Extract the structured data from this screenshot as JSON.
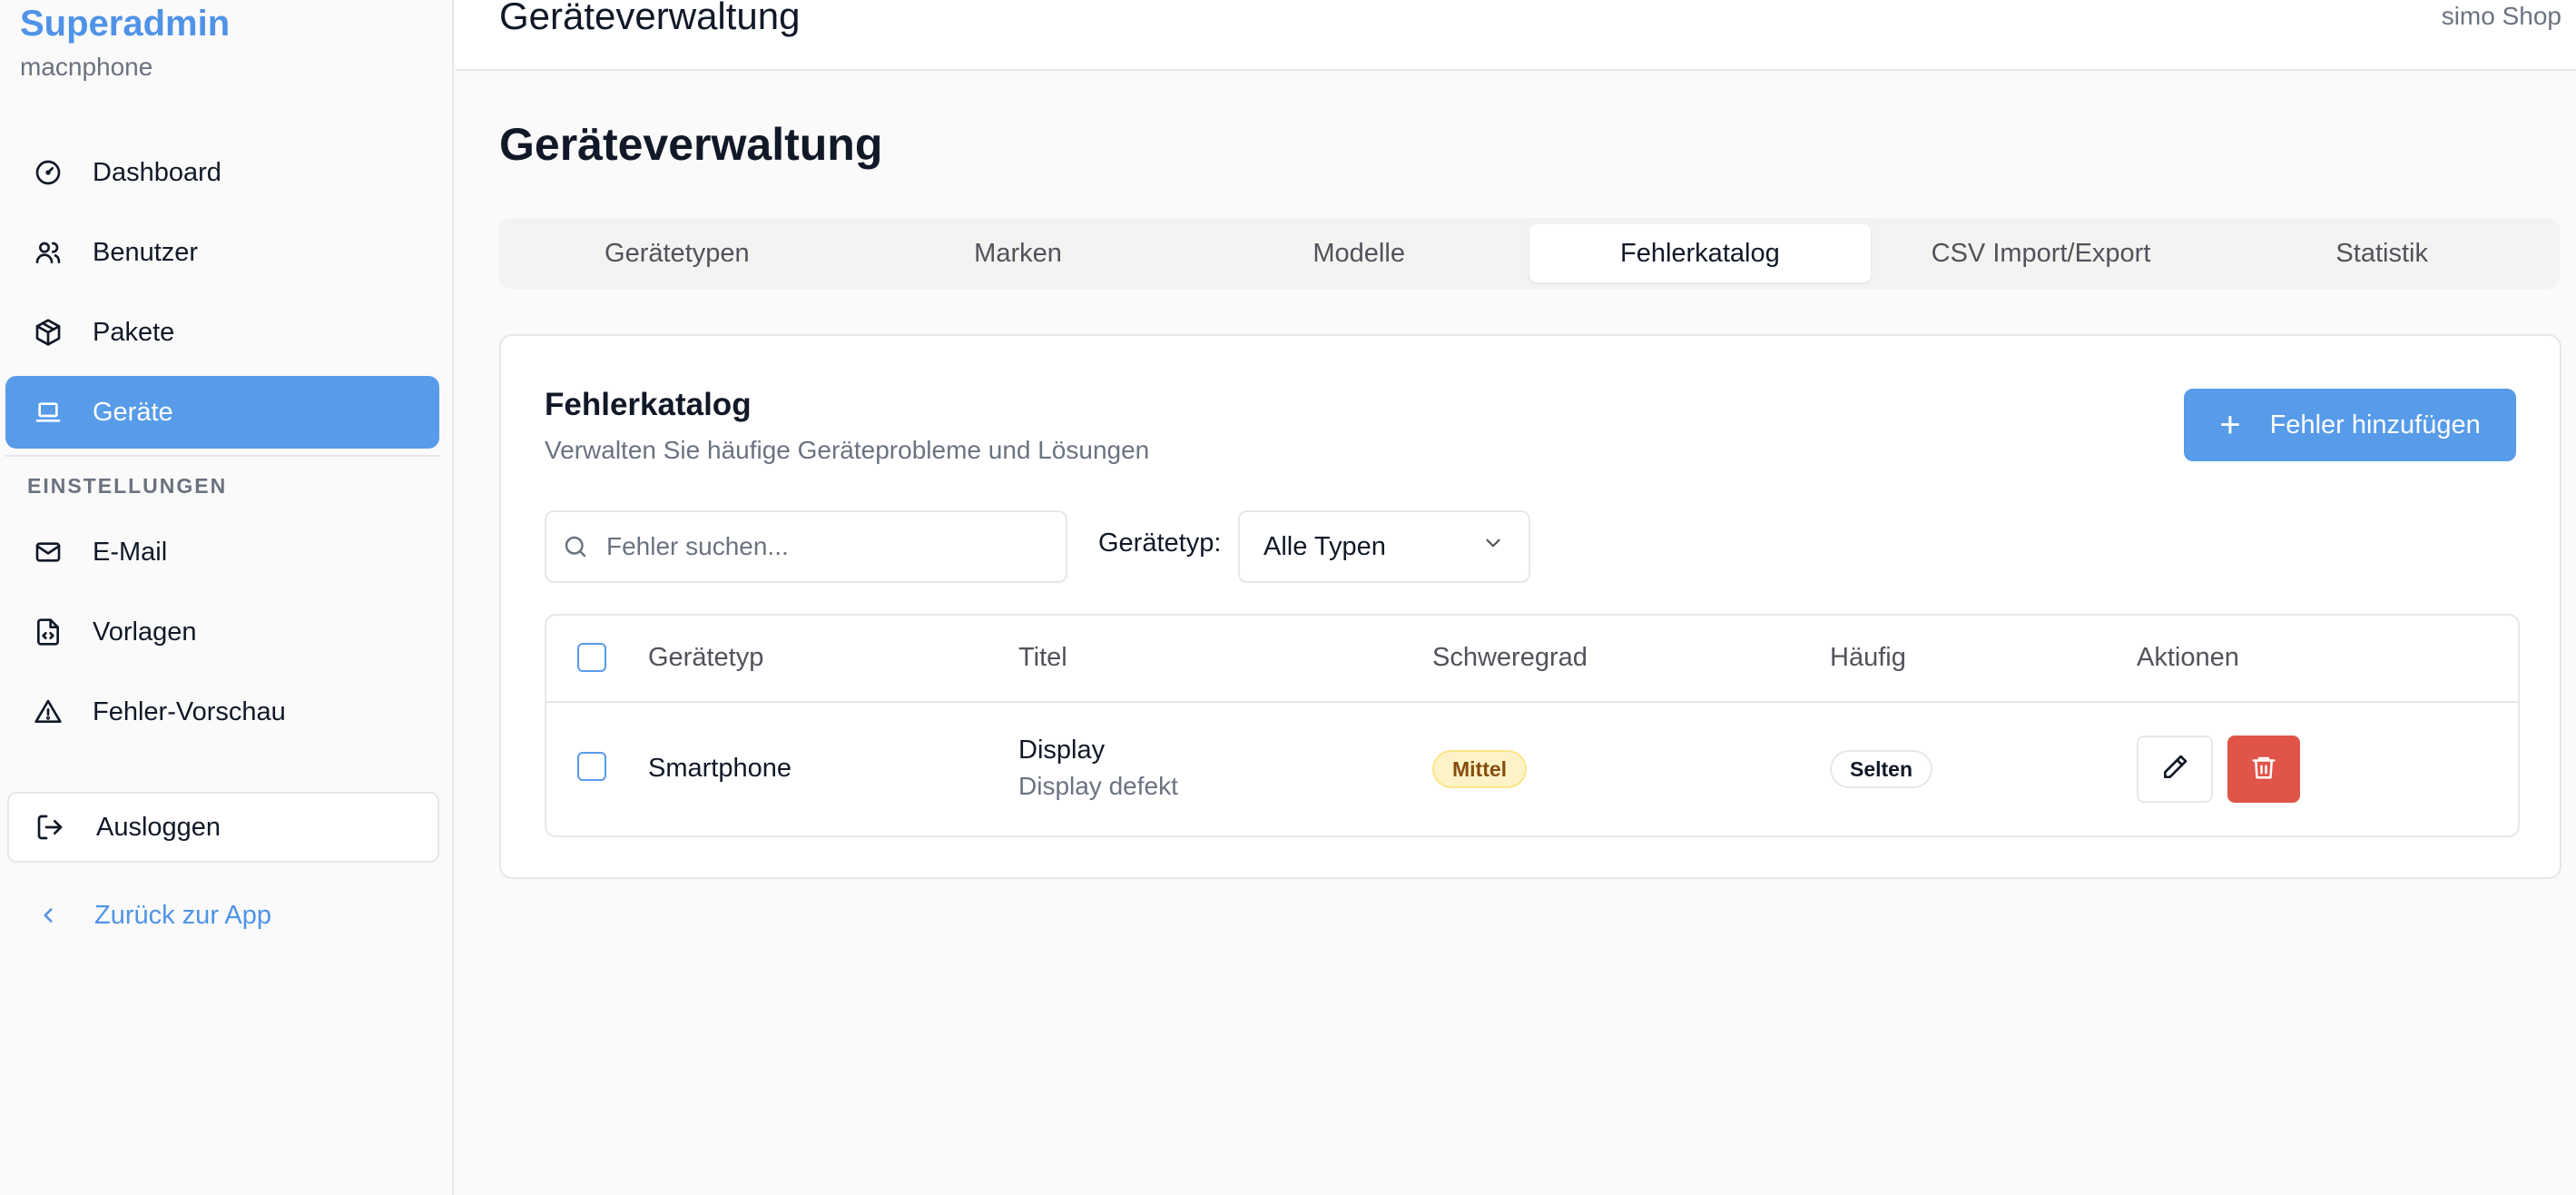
{
  "colors": {
    "accent": "#579be9",
    "brand": "#4f93e8",
    "danger": "#e15449",
    "badge_medium_bg": "#fef3c7"
  },
  "sidebar": {
    "brand_title": "Superadmin",
    "brand_subtitle": "macnphone",
    "items": [
      {
        "label": "Dashboard",
        "icon": "gauge-icon"
      },
      {
        "label": "Benutzer",
        "icon": "users-icon"
      },
      {
        "label": "Pakete",
        "icon": "package-icon"
      },
      {
        "label": "Geräte",
        "icon": "laptop-icon",
        "active": true
      }
    ],
    "section_label": "EINSTELLUNGEN",
    "settings_items": [
      {
        "label": "E-Mail",
        "icon": "mail-icon"
      },
      {
        "label": "Vorlagen",
        "icon": "file-code-icon"
      },
      {
        "label": "Fehler-Vorschau",
        "icon": "alert-triangle-icon"
      }
    ],
    "logout_label": "Ausloggen",
    "back_label": "Zurück zur App"
  },
  "header": {
    "title": "Geräteverwaltung",
    "shop_name": "simo Shop"
  },
  "main": {
    "page_title": "Geräteverwaltung",
    "tabs": [
      {
        "label": "Gerätetypen"
      },
      {
        "label": "Marken"
      },
      {
        "label": "Modelle"
      },
      {
        "label": "Fehlerkatalog",
        "active": true
      },
      {
        "label": "CSV Import/Export"
      },
      {
        "label": "Statistik"
      }
    ],
    "card": {
      "title": "Fehlerkatalog",
      "subtitle": "Verwalten Sie häufige Geräteprobleme und Lösungen",
      "add_button_label": "Fehler hinzufügen",
      "search_placeholder": "Fehler suchen...",
      "filter_label": "Gerätetyp:",
      "filter_value": "Alle Typen",
      "table": {
        "columns": [
          "Gerätetyp",
          "Titel",
          "Schweregrad",
          "Häufig",
          "Aktionen"
        ],
        "rows": [
          {
            "device_type": "Smartphone",
            "title": "Display",
            "description": "Display defekt",
            "severity": "Mittel",
            "frequency": "Selten"
          }
        ]
      }
    }
  }
}
